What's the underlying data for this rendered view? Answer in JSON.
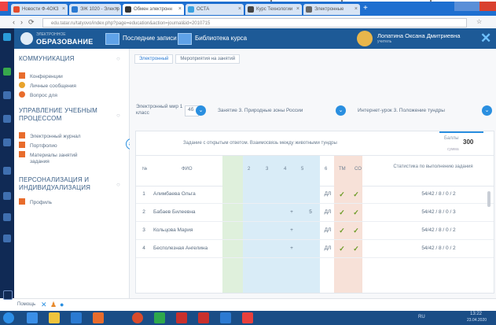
{
  "browser": {
    "tabs": [
      {
        "label": "Новости Ф-4ОКЗ",
        "fav": "#e44b2c"
      },
      {
        "label": "ЭЖ 1020 - Электр",
        "fav": "#2a7ad2"
      },
      {
        "label": "Обмен электронн",
        "fav": "#333333",
        "active": true
      },
      {
        "label": "ОСТА",
        "fav": "#3aa2e0"
      },
      {
        "label": "Курс Технологии",
        "fav": "#444444"
      },
      {
        "label": "Электронные",
        "fav": "#666666"
      }
    ],
    "url": "edu.tatar.ru/tatyovo/index.php?page=education&action=journal&id=2010715"
  },
  "header": {
    "brand_small": "ЭЛЕКТРОННОЕ",
    "brand_big": "ОБРАЗОВАНИЕ",
    "nav1": "Последние записи",
    "nav2": "Библиотека курса",
    "user_name": "Лопатина Оксана Дмитриевна",
    "user_role": "учитель",
    "close": "✕"
  },
  "sidebar": {
    "sec1": "КОММУНИКАЦИЯ",
    "items1": [
      "Конференции",
      "Личные сообщения",
      "Вопрос для"
    ],
    "sec2": "УПРАВЛЕНИЕ УЧЕБНЫМ ПРОЦЕССОМ",
    "items2": [
      "Электронный журнал",
      "Портфолио",
      "Материалы занятий",
      "задания"
    ],
    "sec3": "ПЕРСОНАЛИЗАЦИЯ И ИНДИВИДУАЛИЗАЦИЯ",
    "items3": [
      "Профиль"
    ]
  },
  "content": {
    "crumbs": [
      "Электронный",
      "Мероприятия на занятий"
    ],
    "filters": {
      "label1": "Электронный мир 1 класс",
      "val1": "4б",
      "label2": "Занятие 3. Природные зоны России",
      "label3": "Интернет-урок 3. Положение тундры"
    },
    "task_title": "Задание с открытым ответом. Взаимосвязь между животными тундры",
    "score_label": "Баллы",
    "score_sub": "сумма",
    "score": "300",
    "headers": {
      "num": "№",
      "fio": "ФИО",
      "c1": "1",
      "c2": "2",
      "c3": "3",
      "c4": "4",
      "c5": "5",
      "c6": "6",
      "tm": "ТМ",
      "c7": "СО",
      "stat": "Статистика по выполнению задания"
    },
    "rows": [
      {
        "n": "1",
        "name": "Алимбаева Ольга",
        "c4": "",
        "c5": "",
        "d": "ДЛ",
        "check1": "✓",
        "check2": "✓",
        "stat": "54/42 / 8 / 0 / 2"
      },
      {
        "n": "2",
        "name": "Бабаев Билеевна",
        "c4": "+",
        "c5": "5",
        "d": "ДЛ",
        "check1": "✓",
        "check2": "✓",
        "stat": "54/42 / 8 / 0 / 3"
      },
      {
        "n": "3",
        "name": "Кольцова Мария",
        "c4": "+",
        "c5": "",
        "d": "ДЛ",
        "check1": "✓",
        "check2": "✓",
        "stat": "54/42 / 8 / 0 / 2"
      },
      {
        "n": "4",
        "name": "Бесполезная Ангелина",
        "c4": "+",
        "c5": "",
        "d": "ДЛ",
        "check1": "✓",
        "check2": "✓",
        "stat": "54/42 / 8 / 0 / 2"
      }
    ]
  },
  "footer": {
    "text": "Помощь"
  },
  "taskbar": {
    "lang": "RU",
    "time": "13:22",
    "date": "23.04.2020"
  }
}
